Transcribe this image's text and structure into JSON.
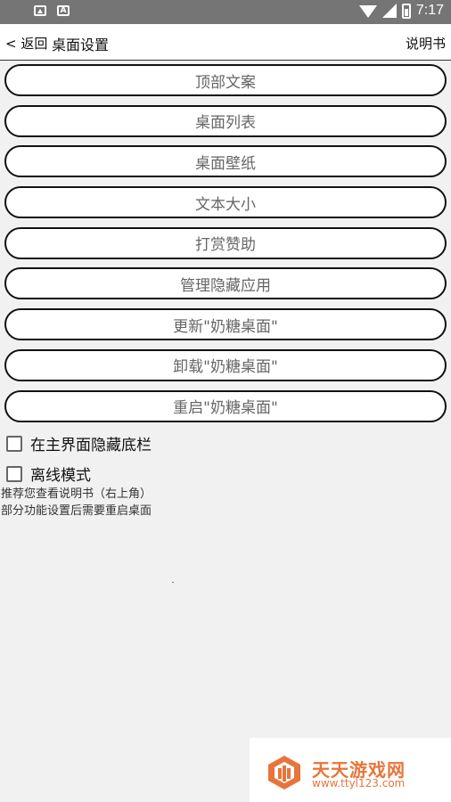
{
  "status_bar": {
    "time": "7:17",
    "icons": [
      "image-icon",
      "a-icon",
      "wifi-icon",
      "signal-icon",
      "battery-icon"
    ]
  },
  "header": {
    "back_label": "< 返回",
    "title": "桌面设置",
    "manual_label": "说明书"
  },
  "menu": {
    "items": [
      {
        "label": "顶部文案"
      },
      {
        "label": "桌面列表"
      },
      {
        "label": "桌面壁纸"
      },
      {
        "label": "文本大小"
      },
      {
        "label": "打赏赞助"
      },
      {
        "label": "管理隐藏应用"
      },
      {
        "label": "更新\"奶糖桌面\""
      },
      {
        "label": "卸载\"奶糖桌面\""
      },
      {
        "label": "重启\"奶糖桌面\""
      }
    ]
  },
  "options": {
    "hide_bottom_bar": {
      "label": "在主界面隐藏底栏",
      "checked": false
    },
    "offline_mode": {
      "label": "离线模式",
      "checked": false
    }
  },
  "notes": {
    "line1": "推荐您查看说明书（右上角）",
    "line2": "部分功能设置后需要重启桌面"
  },
  "watermark": {
    "title": "天天游戏网",
    "url": "www.ttyl123.com"
  },
  "colors": {
    "watermark": "#e8743b",
    "status_bar": "#757575"
  }
}
